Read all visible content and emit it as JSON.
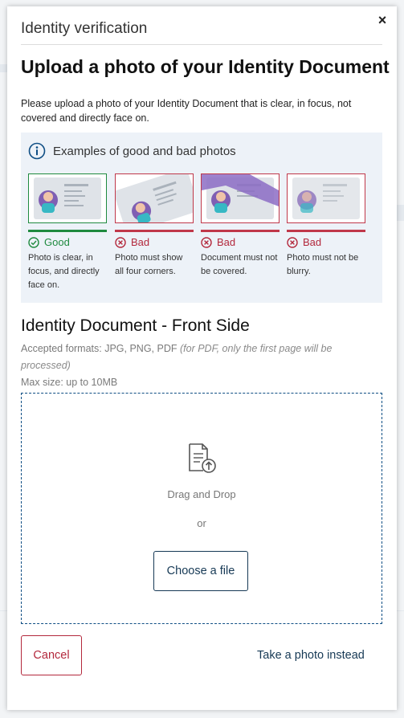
{
  "modal": {
    "title": "Identity verification",
    "close_label": "×",
    "heading": "Upload a photo of your Identity Document",
    "intro": "Please upload a photo of your Identity Document that is clear, in focus, not covered and directly face on."
  },
  "examples": {
    "title": "Examples of good and bad photos",
    "items": [
      {
        "status": "Good",
        "description": "Photo is clear, in focus, and directly face on."
      },
      {
        "status": "Bad",
        "description": "Photo must show all four corners."
      },
      {
        "status": "Bad",
        "description": "Document must not be covered."
      },
      {
        "status": "Bad",
        "description": "Photo must not be blurry."
      }
    ]
  },
  "upload": {
    "section_title": "Identity Document - Front Side",
    "formats": "Accepted formats: JPG, PNG, PDF",
    "formats_note": "(for PDF, only the first page will be processed)",
    "max_size": "Max size: up to 10MB",
    "drag_drop": "Drag and Drop",
    "or": "or",
    "choose_file": "Choose a file"
  },
  "footer": {
    "cancel": "Cancel",
    "take_photo": "Take a photo instead"
  },
  "colors": {
    "good": "#1f8a3f",
    "bad": "#b3283c",
    "primary": "#163955",
    "dropzone_border": "#0f4e84",
    "examples_bg": "#edf2f8"
  }
}
